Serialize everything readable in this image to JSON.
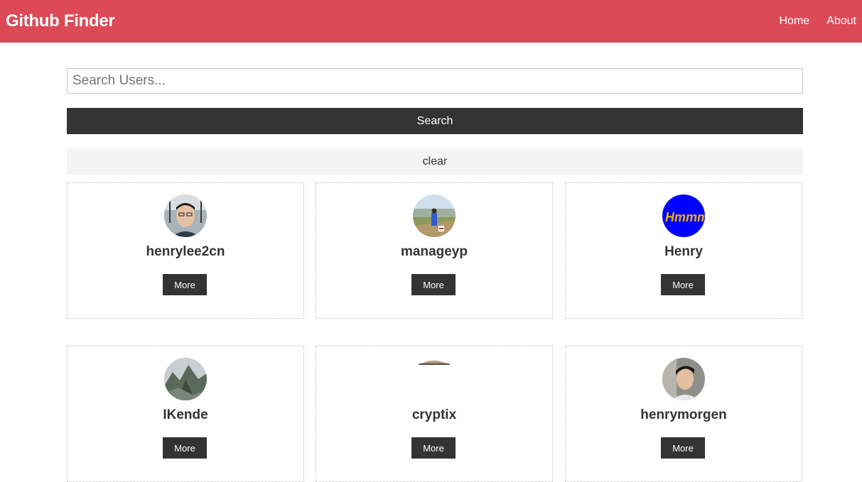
{
  "navbar": {
    "brand": "Github Finder",
    "links": [
      {
        "label": "Home"
      },
      {
        "label": "About"
      }
    ],
    "color": "#dc4a58"
  },
  "search": {
    "placeholder": "Search Users...",
    "value": "",
    "button_label": "Search"
  },
  "clear": {
    "label": "clear"
  },
  "users": [
    {
      "login": "henrylee2cn",
      "more_label": "More",
      "avatar_icon": "avatar-photo-person"
    },
    {
      "login": "manageyp",
      "more_label": "More",
      "avatar_icon": "avatar-photo-landscape"
    },
    {
      "login": "Henry",
      "more_label": "More",
      "avatar_icon": "avatar-hmmm-logo",
      "avatar_text": "Hmmm"
    },
    {
      "login": "IKende",
      "more_label": "More",
      "avatar_icon": "avatar-photo-mountain"
    },
    {
      "login": "cryptix",
      "more_label": "More",
      "avatar_icon": "avatar-photo-partial"
    },
    {
      "login": "henrymorgen",
      "more_label": "More",
      "avatar_icon": "avatar-photo-person"
    }
  ],
  "colors": {
    "dark": "#333333",
    "light": "#f4f4f4",
    "accent": "#dc4a58"
  }
}
